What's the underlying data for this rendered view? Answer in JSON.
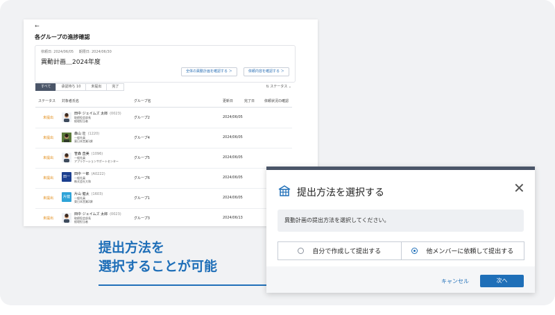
{
  "colors": {
    "accent": "#1f6fb8",
    "status_pending": "#e28a12",
    "header_bar": "#4a5568"
  },
  "screen": {
    "back_icon": "←",
    "title": "各グループの進捗確認",
    "card": {
      "request_date": "依頼日: 2024/06/05",
      "due_date": "期限日: 2024/06/30",
      "plan_title": "異動計画＿2024年度",
      "btn_overall": "全体の異動計画を確認する ＞",
      "btn_request": "依頼内容を確認する ＞"
    },
    "tabs": [
      "すべて",
      "承認待ち 10",
      "未提出",
      "完了"
    ],
    "status_filter": "ステータス ⌄",
    "columns": {
      "status": "ステータス",
      "target": "対象者氏名",
      "group": "グループ名",
      "updated": "更新日",
      "done": "完了日",
      "confirm": "依頼状況の確認"
    },
    "rows": [
      {
        "status": "未提出",
        "name": "田中 ジェイムズ 太郎",
        "id": "(0023)",
        "dept": "取締役会部長",
        "title": "経理担当者",
        "group": "グループ2",
        "updated": "2024/06/05",
        "avatar": "person"
      },
      {
        "status": "未提出",
        "name": "森山 壮",
        "id": "(1220)",
        "dept": "一般社員",
        "title": "東日本営業1課",
        "group": "グループ4",
        "updated": "2024/06/05",
        "avatar": "photo"
      },
      {
        "status": "未提出",
        "name": "笹森 直美",
        "id": "(1096)",
        "dept": "一般社員",
        "title": "アプリケーションサポートセンター",
        "group": "グループ5",
        "updated": "2024/06/05",
        "avatar": "person"
      },
      {
        "status": "未提出",
        "name": "田中 一郎",
        "id": "(A0222)",
        "dept": "一般社員",
        "title": "株式会社大和",
        "group": "グループ6",
        "updated": "2024/06/05",
        "avatar": "田一"
      },
      {
        "status": "未提出",
        "name": "片山 健太",
        "id": "(1603)",
        "dept": "一般社員",
        "title": "東日本営業2課",
        "group": "グループ1",
        "updated": "2024/06/05",
        "avatar": "片健"
      },
      {
        "status": "未提出",
        "name": "田中 ジェイムズ 太郎",
        "id": "(0023)",
        "dept": "取締役会部長",
        "title": "経理担当者",
        "group": "グループ3",
        "updated": "2024/06/13",
        "avatar": "person"
      }
    ]
  },
  "callout": {
    "line1": "提出方法を",
    "line2": "選択することが可能"
  },
  "modal": {
    "icon": "building-icon",
    "title": "提出方法を選択する",
    "close": "✕",
    "message": "異動計画の提出方法を選択してください。",
    "option_self": "自分で作成して提出する",
    "option_other": "他メンバーに依頼して提出する",
    "selected": "option_other",
    "cancel": "キャンセル",
    "next": "次へ"
  }
}
